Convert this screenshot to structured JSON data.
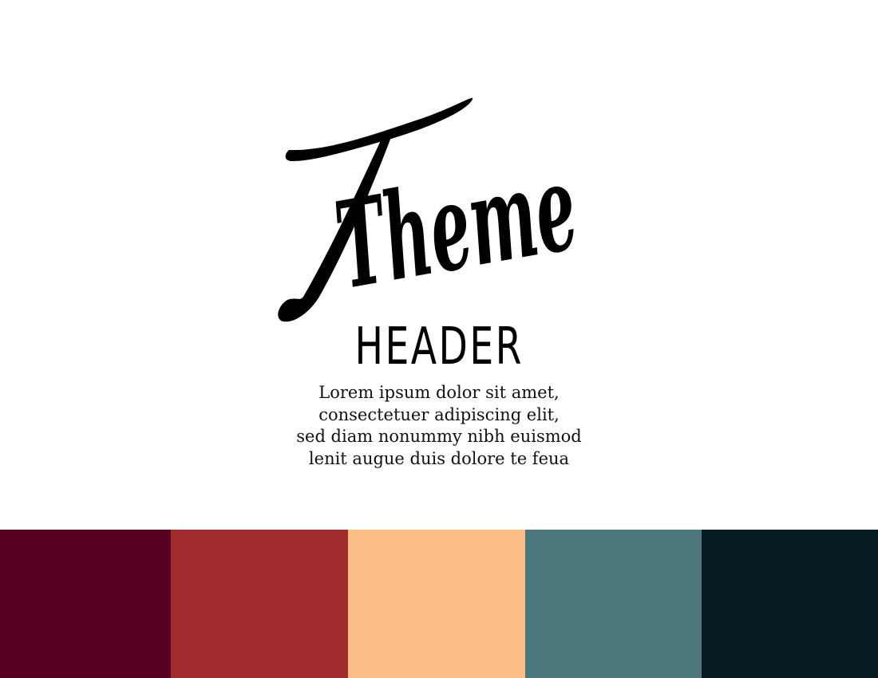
{
  "title": {
    "script_word": "Theme",
    "header_word": "HEADER"
  },
  "body": {
    "lines": [
      "Lorem ipsum dolor sit amet,",
      "consectetuer adipiscing elit,",
      "sed diam nonummy nibh euismod",
      "lenit augue duis dolore te feua"
    ]
  },
  "palette": {
    "colors": [
      "#570022",
      "#a22c2e",
      "#fbbf86",
      "#4c787d",
      "#061c23"
    ]
  }
}
